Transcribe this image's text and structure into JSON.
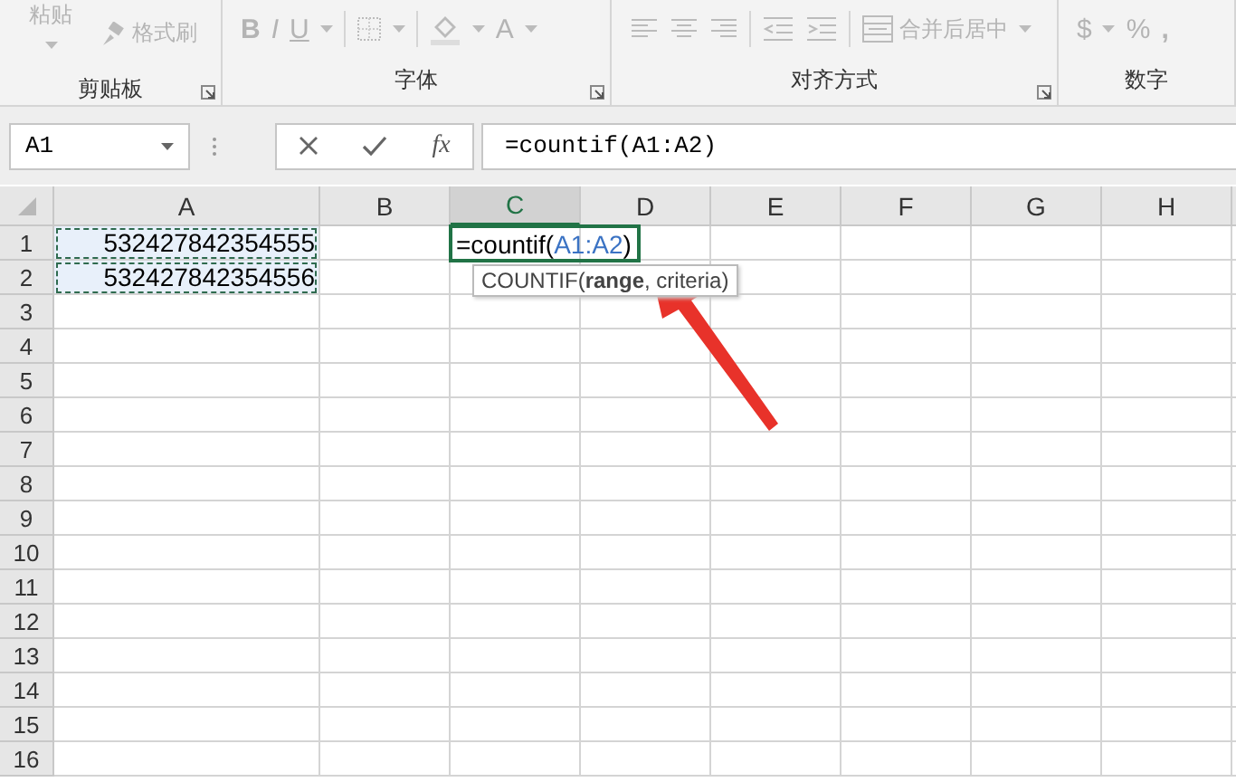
{
  "ribbon": {
    "groups": [
      {
        "label": "剪贴板",
        "launcher": true,
        "tools": [
          {
            "kind": "paste",
            "text": "粘贴"
          },
          {
            "kind": "brush",
            "text": "格式刷"
          }
        ]
      },
      {
        "label": "字体",
        "launcher": true,
        "tools": [
          {
            "kind": "bold",
            "text": "B"
          },
          {
            "kind": "italic",
            "text": "I"
          },
          {
            "kind": "underline",
            "text": "U"
          },
          {
            "kind": "caret"
          },
          {
            "kind": "sep"
          },
          {
            "kind": "border"
          },
          {
            "kind": "caret"
          },
          {
            "kind": "sep"
          },
          {
            "kind": "fill"
          },
          {
            "kind": "caret"
          },
          {
            "kind": "letter",
            "text": "A"
          },
          {
            "kind": "caret"
          }
        ]
      },
      {
        "label": "对齐方式",
        "launcher": true,
        "tools": [
          {
            "kind": "alignleft"
          },
          {
            "kind": "aligncenter"
          },
          {
            "kind": "alignright"
          },
          {
            "kind": "sep"
          },
          {
            "kind": "outdent"
          },
          {
            "kind": "indent"
          },
          {
            "kind": "sep"
          },
          {
            "kind": "merge",
            "text": "合并后居中"
          },
          {
            "kind": "caret"
          }
        ]
      },
      {
        "label": "数字",
        "tools": [
          {
            "kind": "letter",
            "text": "$"
          },
          {
            "kind": "caret"
          },
          {
            "kind": "letter",
            "text": "%"
          },
          {
            "kind": "bold",
            "text": ","
          }
        ]
      }
    ]
  },
  "formula_bar": {
    "name_box": "A1",
    "fx": "fx",
    "formula": "=countif(A1:A2)"
  },
  "sheet": {
    "columns": [
      {
        "label": "A",
        "selected": false
      },
      {
        "label": "B",
        "selected": false
      },
      {
        "label": "C",
        "selected": true
      },
      {
        "label": "D",
        "selected": false
      },
      {
        "label": "E",
        "selected": false
      },
      {
        "label": "F",
        "selected": false
      },
      {
        "label": "G",
        "selected": false
      },
      {
        "label": "H",
        "selected": false
      }
    ],
    "rows": [
      {
        "label": "1",
        "cells": [
          {
            "kind": "number",
            "text": "532427842354555",
            "copied": true
          },
          {
            "kind": "empty"
          },
          {
            "kind": "formula",
            "active": true,
            "prefix": "=countif(",
            "ref": "A1:A2",
            "suffix": ")",
            "hint": "COUNTIF(**range**, criteria)"
          }
        ]
      },
      {
        "label": "2",
        "cells": [
          {
            "kind": "number",
            "text": "532427842354556",
            "copied": true
          }
        ]
      },
      {
        "label": "3"
      },
      {
        "label": "4"
      },
      {
        "label": "5"
      },
      {
        "label": "6"
      },
      {
        "label": "7"
      },
      {
        "label": "8"
      },
      {
        "label": "9"
      },
      {
        "label": "10"
      },
      {
        "label": "11"
      },
      {
        "label": "12"
      },
      {
        "label": "13"
      },
      {
        "label": "14"
      },
      {
        "label": "15"
      },
      {
        "label": "16"
      }
    ]
  },
  "annotation": {
    "kind": "arrow"
  }
}
